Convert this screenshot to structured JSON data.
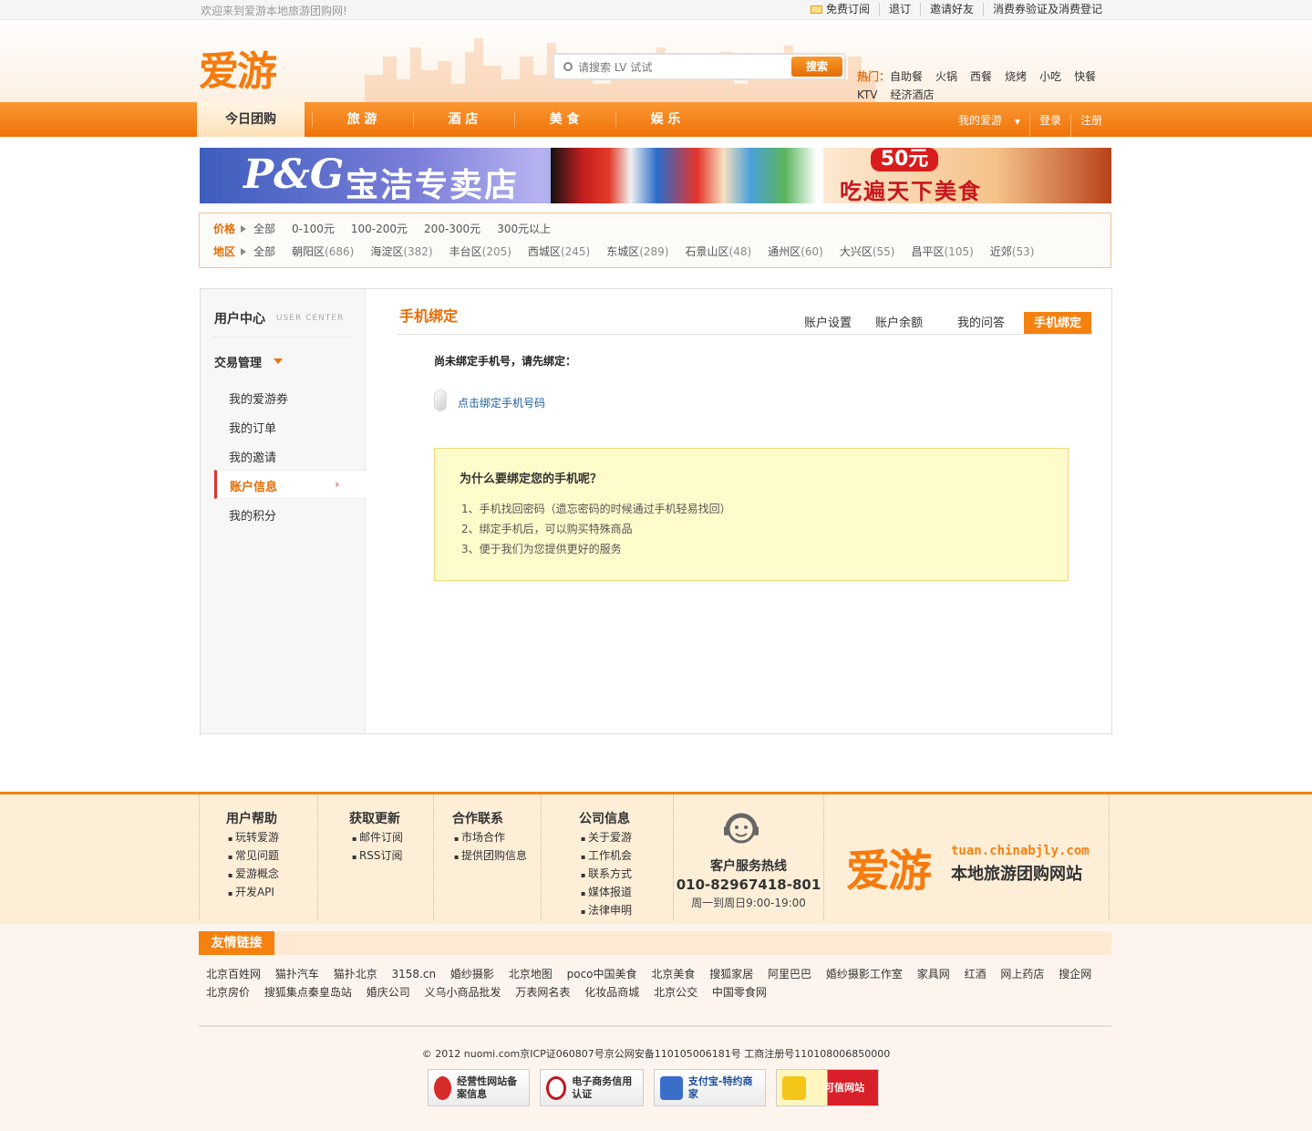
{
  "topbar": {
    "welcome": "欢迎来到爱游本地旅游团购网!",
    "links": [
      "免费订阅",
      "退订",
      "邀请好友",
      "消费券验证及消费登记"
    ]
  },
  "header": {
    "logo": "爱游",
    "search_placeholder": "请搜索 LV 试试",
    "search_button": "搜索",
    "hot_label": "热门：",
    "hot_words": [
      "自助餐",
      "火锅",
      "西餐",
      "烧烤",
      "小吃",
      "快餐",
      "KTV",
      "经济酒店"
    ]
  },
  "nav": {
    "items": [
      "今日团购",
      "旅 游",
      "酒 店",
      "美 食",
      "娱 乐"
    ],
    "right": [
      "我的爱游",
      "登录",
      "注册"
    ]
  },
  "banners": {
    "left_brand": "P&G",
    "left_text": "宝洁专卖店",
    "right_price": "50元",
    "right_text": "吃遍天下美食"
  },
  "filter": {
    "price_label": "价格",
    "price_options": [
      "全部",
      "0-100元",
      "100-200元",
      "200-300元",
      "300元以上"
    ],
    "area_label": "地区",
    "area_options": [
      {
        "name": "全部",
        "count": ""
      },
      {
        "name": "朝阳区",
        "count": "(686)"
      },
      {
        "name": "海淀区",
        "count": "(382)"
      },
      {
        "name": "丰台区",
        "count": "(205)"
      },
      {
        "name": "西城区",
        "count": "(245)"
      },
      {
        "name": "东城区",
        "count": "(289)"
      },
      {
        "name": "石景山区",
        "count": "(48)"
      },
      {
        "name": "通州区",
        "count": "(60)"
      },
      {
        "name": "大兴区",
        "count": "(55)"
      },
      {
        "name": "昌平区",
        "count": "(105)"
      },
      {
        "name": "近郊",
        "count": "(53)"
      }
    ]
  },
  "sidebar": {
    "title": "用户中心",
    "title_en": "USER CENTER",
    "section": "交易管理",
    "items": [
      "我的爱游券",
      "我的订单",
      "我的邀请",
      "账户信息",
      "我的积分"
    ],
    "active_arrow": "›"
  },
  "main": {
    "title": "手机绑定",
    "tabs": [
      "账户设置",
      "账户余额",
      "我的问答",
      "手机绑定"
    ],
    "notice": "尚未绑定手机号，请先绑定：",
    "bind_link": "点击绑定手机号码",
    "why_title": "为什么要绑定您的手机呢？",
    "why_items": [
      "1、手机找回密码（遗忘密码的时候通过手机轻易找回）",
      "2、绑定手机后，可以购买特殊商品",
      "3、便于我们为您提供更好的服务"
    ]
  },
  "footer": {
    "cols": [
      {
        "title": "用户帮助",
        "links": [
          "玩转爱游",
          "常见问题",
          "爱游概念",
          "开发API"
        ]
      },
      {
        "title": "获取更新",
        "links": [
          "邮件订阅",
          "RSS订阅"
        ]
      },
      {
        "title": "合作联系",
        "links": [
          "市场合作",
          "提供团购信息"
        ]
      },
      {
        "title": "公司信息",
        "links": [
          "关于爱游",
          "工作机会",
          "联系方式",
          "媒体报道",
          "法律申明"
        ]
      }
    ],
    "service_title": "客户服务热线",
    "service_phone": "010-82967418-801",
    "service_hours": "周一到周日9:00-19:00",
    "logo": "爱游",
    "site": "tuan.chinabjly.com",
    "slogan": "本地旅游团购网站"
  },
  "friend_links": {
    "title": "友情链接",
    "links": [
      "北京百姓网",
      "猫扑汽车",
      "猫扑北京",
      "3158.cn",
      "婚纱摄影",
      "北京地图",
      "poco中国美食",
      "北京美食",
      "搜狐家居",
      "阿里巴巴",
      "婚纱摄影工作室",
      "家具网",
      "红酒",
      "网上药店",
      "搜企网",
      "北京房价",
      "搜狐集点秦皇岛站",
      "婚庆公司",
      "义乌小商品批发",
      "万表网名表",
      "化妆品商城",
      "北京公交",
      "中国零食网"
    ]
  },
  "copyright": "© 2012 nuomi.com京ICP证060807号京公网安备110105006181号 工商注册号110108006850000",
  "badges": [
    "经营性网站备案信息",
    "电子商务信用认证",
    "支付宝-特约商家",
    "可信网站"
  ],
  "colors": {
    "accent": "#f5810f",
    "link": "#1d5e9e",
    "active_border": "#e0322b"
  }
}
